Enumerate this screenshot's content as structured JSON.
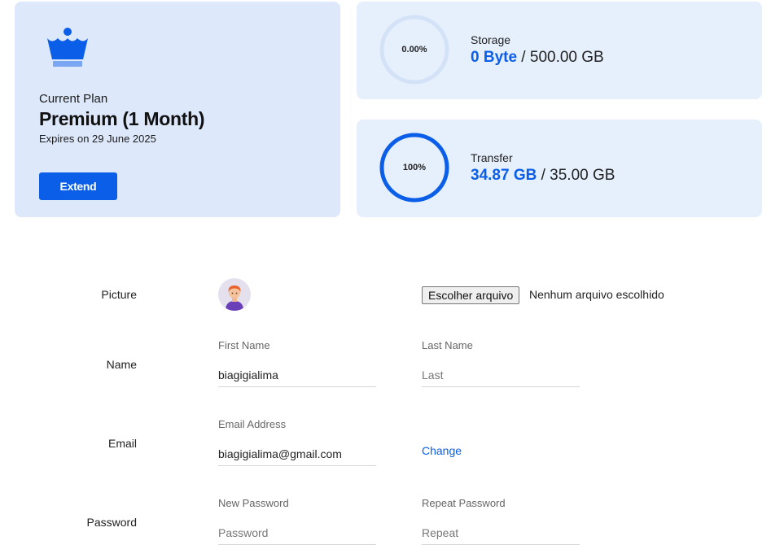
{
  "plan": {
    "label": "Current Plan",
    "name": "Premium (1 Month)",
    "expiry": "Expires on 29 June 2025",
    "extend_label": "Extend",
    "icon": "crown-icon"
  },
  "storage": {
    "percent_label": "0.00%",
    "percent": 0,
    "label": "Storage",
    "used": "0 Byte",
    "separator": " / ",
    "total": "500.00 GB"
  },
  "transfer": {
    "percent_label": "100%",
    "percent": 100,
    "label": "Transfer",
    "used": "34.87 GB",
    "separator": " / ",
    "total": "35.00 GB"
  },
  "profile": {
    "picture": {
      "label": "Picture",
      "file_button": "Escolher arquivo",
      "file_status": "Nenhum arquivo escolhido"
    },
    "name": {
      "label": "Name",
      "first_label": "First Name",
      "first_value": "biagigialima",
      "last_label": "Last Name",
      "last_placeholder": "Last"
    },
    "email": {
      "label": "Email",
      "field_label": "Email Address",
      "value": "biagigialima@gmail.com",
      "change_label": "Change"
    },
    "password": {
      "label": "Password",
      "new_label": "New Password",
      "new_placeholder": "Password",
      "repeat_label": "Repeat Password",
      "repeat_placeholder": "Repeat"
    }
  },
  "colors": {
    "accent": "#0a5ee8",
    "plan_card": "#dde9fb",
    "stat_card": "#e6effc",
    "ring_track": "#d4e2f7"
  }
}
